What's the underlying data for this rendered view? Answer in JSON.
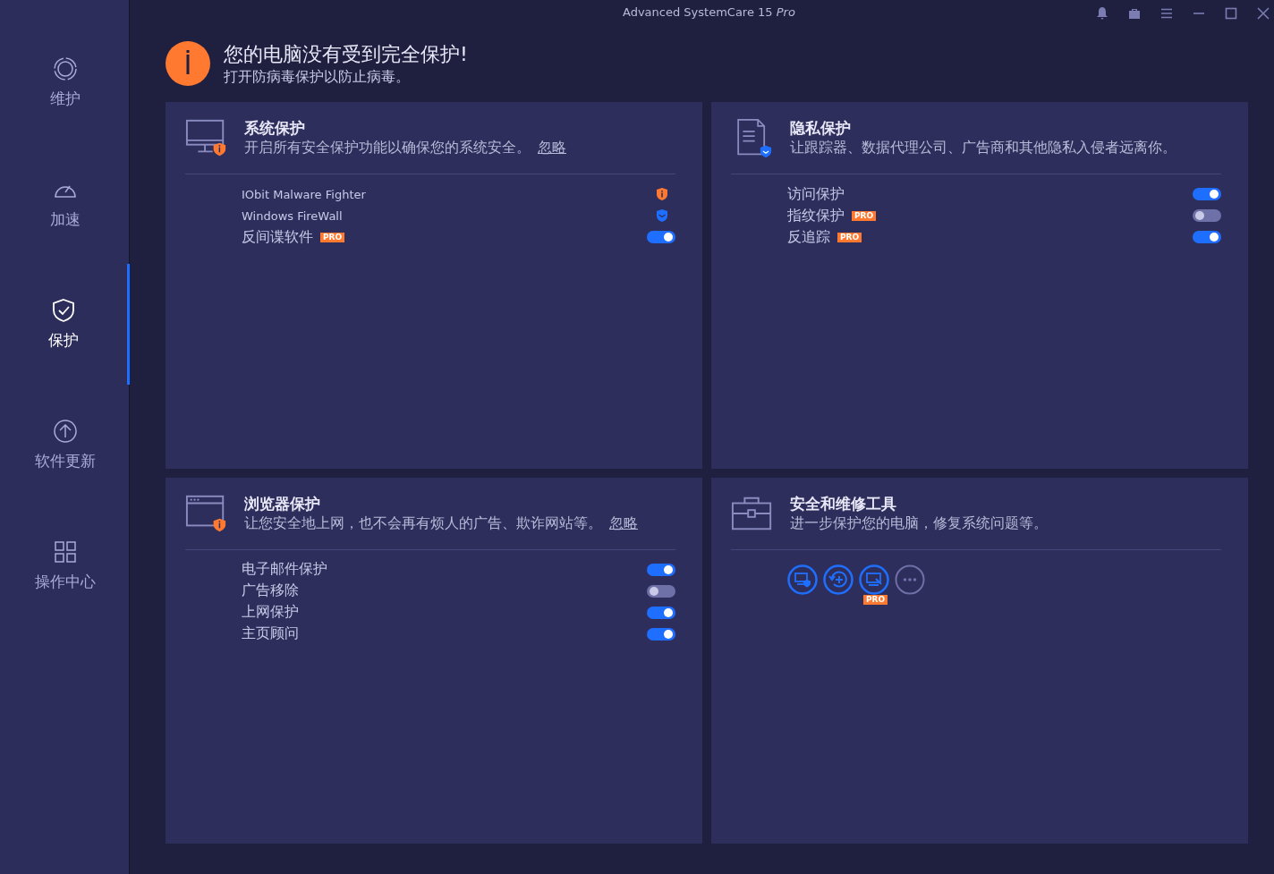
{
  "window": {
    "title": "Advanced SystemCare 15 *Pro*"
  },
  "sidebar": {
    "items": [
      {
        "label": "维护",
        "kind": "rings",
        "selected": false
      },
      {
        "label": "加速",
        "kind": "gauge",
        "selected": false
      },
      {
        "label": "保护",
        "kind": "shield",
        "selected": true
      },
      {
        "label": "软件更新",
        "kind": "update",
        "selected": false
      },
      {
        "label": "操作中心",
        "kind": "grid",
        "selected": false
      }
    ]
  },
  "alert": {
    "title": "您的电脑没有受到完全保护!",
    "subtitle": "打开防病毒保护以防止病毒。"
  },
  "cards": [
    {
      "kind": "monitor",
      "title": "系统保护",
      "description": "开启所有安全保护功能以确保您的系统安全。",
      "ignore_link": "忽略",
      "rows": [
        {
          "kind": "warning",
          "label": "IObit Malware Fighter"
        },
        {
          "kind": "ok",
          "label": "Windows FireWall"
        },
        {
          "kind": "toggle",
          "label": "反间谍软件",
          "badge": "PRO",
          "on": true
        }
      ]
    },
    {
      "kind": "document",
      "title": "隐私保护",
      "description": "让跟踪器、数据代理公司、广告商和其他隐私入侵者远离你。",
      "rows": [
        {
          "kind": "toggle",
          "label": "访问保护",
          "on": true
        },
        {
          "kind": "toggle",
          "label": "指纹保护",
          "badge": "PRO",
          "on": false
        },
        {
          "kind": "toggle",
          "label": "反追踪",
          "badge": "PRO",
          "on": true
        }
      ]
    },
    {
      "kind": "browser",
      "title": "浏览器保护",
      "description": "让您安全地上网，也不会再有烦人的广告、欺诈网站等。",
      "ignore_link": "忽略",
      "rows": [
        {
          "kind": "toggle",
          "label": "电子邮件保护",
          "on": true
        },
        {
          "kind": "toggle",
          "label": "广告移除",
          "on": false
        },
        {
          "kind": "toggle",
          "label": "上网保护",
          "on": true
        },
        {
          "kind": "toggle",
          "label": "主页顾问",
          "on": true
        }
      ]
    },
    {
      "kind": "toolbox",
      "title": "安全和维修工具",
      "description": "进一步保护您的电脑，修复系统问题等。",
      "tools": [
        {
          "kind": "pc-shield"
        },
        {
          "kind": "restore"
        },
        {
          "kind": "pc-repair",
          "badge": "PRO"
        },
        {
          "kind": "more"
        }
      ]
    }
  ]
}
